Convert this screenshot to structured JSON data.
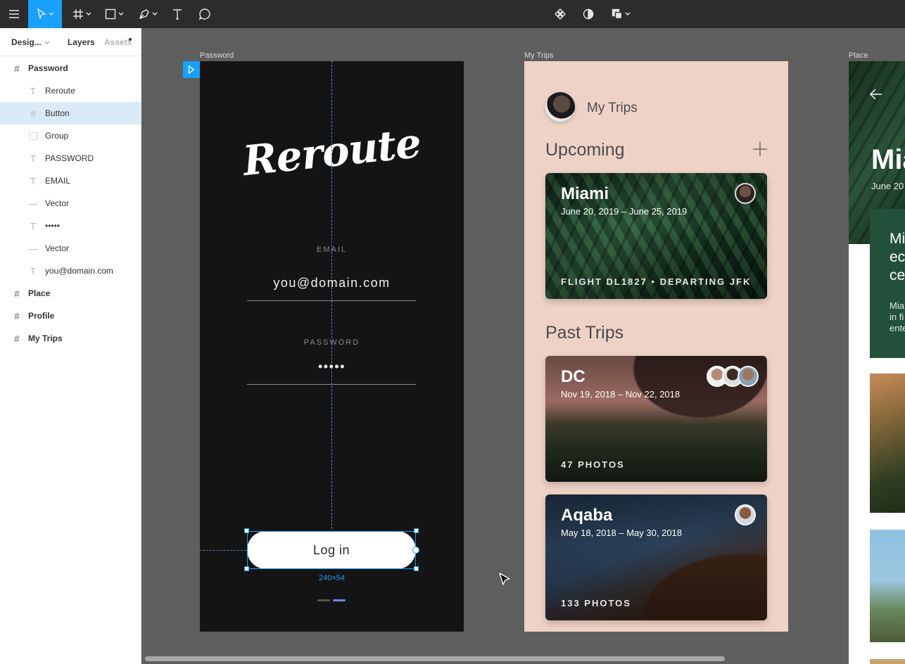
{
  "toolbar": {
    "tools": [
      {
        "name": "menu-icon"
      },
      {
        "name": "move-tool-icon",
        "active": true
      },
      {
        "name": "frame-tool-icon"
      },
      {
        "name": "shape-tool-icon"
      },
      {
        "name": "pen-tool-icon"
      },
      {
        "name": "text-tool-icon"
      },
      {
        "name": "comment-tool-icon"
      }
    ],
    "center_tools": [
      {
        "name": "component-icon"
      },
      {
        "name": "mask-icon"
      },
      {
        "name": "boolean-icon"
      }
    ],
    "accent_color": "#18a0fb"
  },
  "left_panel": {
    "tabs": {
      "design": "Desig...",
      "layers": "Layers",
      "assets": "Assets"
    },
    "layers": [
      {
        "label": "Password",
        "type": "frame",
        "level": 0
      },
      {
        "label": "Reroute",
        "type": "text",
        "level": 1
      },
      {
        "label": "Button",
        "type": "frame",
        "level": 1,
        "selected": true
      },
      {
        "label": "Group",
        "type": "group",
        "level": 1
      },
      {
        "label": "PASSWORD",
        "type": "text",
        "level": 1
      },
      {
        "label": "EMAIL",
        "type": "text",
        "level": 1
      },
      {
        "label": "Vector",
        "type": "vector",
        "level": 1
      },
      {
        "label": "•••••",
        "type": "text",
        "level": 1
      },
      {
        "label": "Vector",
        "type": "vector",
        "level": 1
      },
      {
        "label": "you@domain.com",
        "type": "text",
        "level": 1
      },
      {
        "label": "Place",
        "type": "frame",
        "level": 0
      },
      {
        "label": "Profile",
        "type": "frame",
        "level": 0
      },
      {
        "label": "My Trips",
        "type": "frame",
        "level": 0
      }
    ]
  },
  "canvas": {
    "frame_labels": {
      "password": "Password",
      "trips": "My Trips",
      "place": "Place"
    },
    "password_screen": {
      "logo": "Reroute",
      "email_label": "EMAIL",
      "email_value": "you@domain.com",
      "password_label": "PASSWORD",
      "password_value": "•••••",
      "login_label": "Log in",
      "selection_size": "240×54"
    },
    "trips_screen": {
      "header_title": "My Trips",
      "upcoming_title": "Upcoming",
      "past_title": "Past Trips",
      "upcoming": [
        {
          "city": "Miami",
          "dates": "June 20, 2019 – June 25, 2019",
          "footer": "FLIGHT DL1827 • DEPARTING JFK"
        }
      ],
      "past": [
        {
          "city": "DC",
          "dates": "Nov 19, 2018 – Nov 22, 2018",
          "footer": "47 PHOTOS"
        },
        {
          "city": "Aqaba",
          "dates": "May 18, 2018 – May 30, 2018",
          "footer": "133 PHOTOS"
        }
      ],
      "background_color": "#efd2c7"
    },
    "place_screen": {
      "hero_title": "Mia",
      "hero_sub": "June 20",
      "green_text": [
        "Mi",
        "ec",
        "ce"
      ],
      "green_small": [
        "Mia",
        "in fi",
        "ente"
      ]
    }
  }
}
